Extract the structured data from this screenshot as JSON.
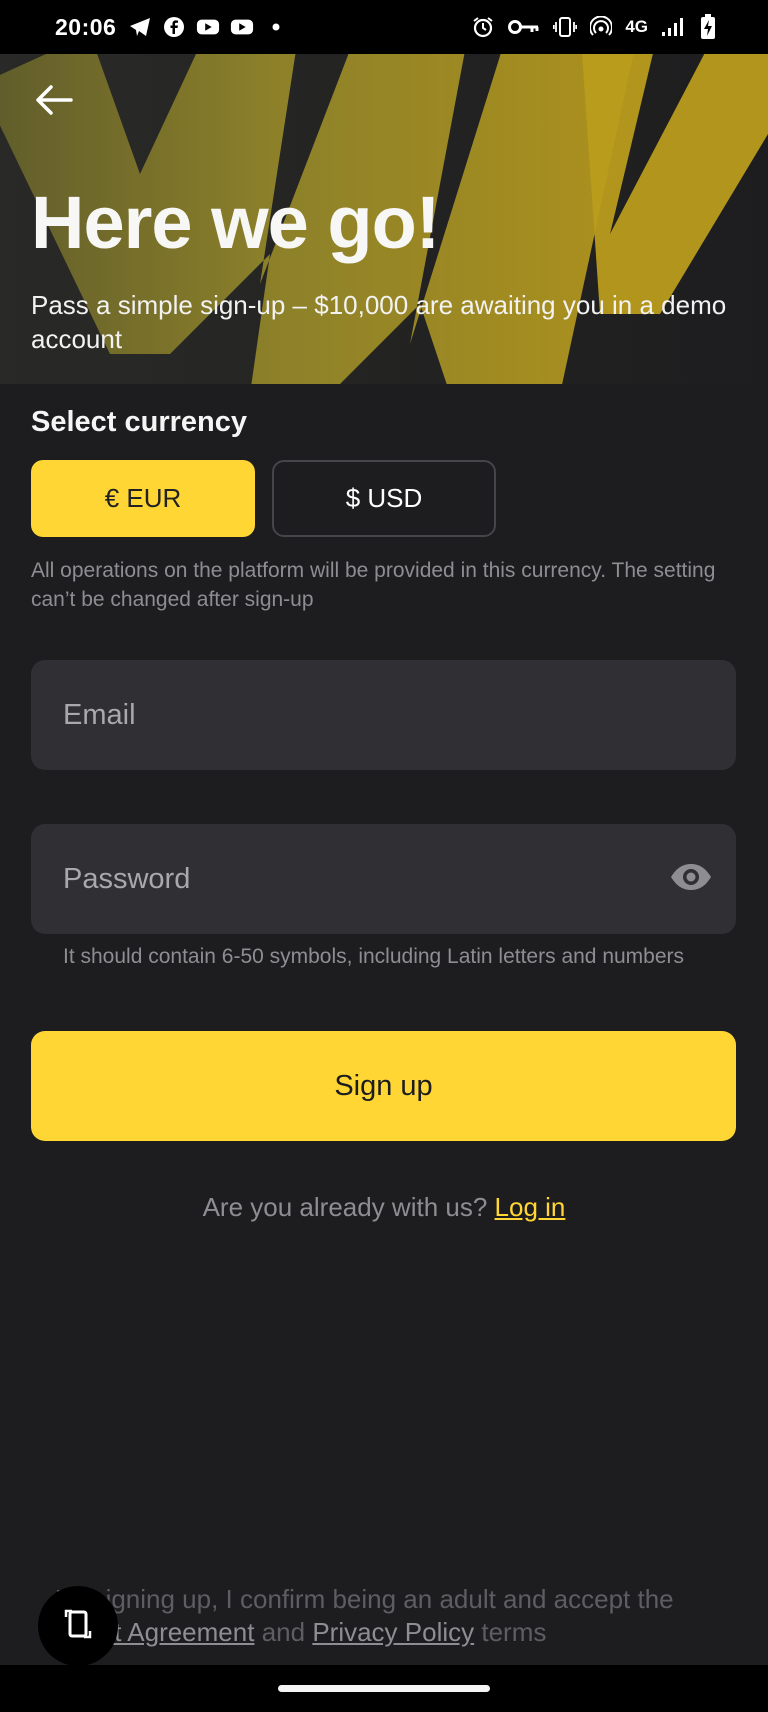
{
  "status_bar": {
    "time": "20:06",
    "network": "4G",
    "left_icons": [
      "telegram-icon",
      "facebook-icon",
      "youtube-icon",
      "youtube-icon",
      "dot-icon"
    ],
    "right_icons": [
      "alarm-icon",
      "key-icon",
      "vibrate-icon",
      "hotspot-icon",
      "signal-icon",
      "battery-icon"
    ]
  },
  "header": {
    "back_icon": "arrow-left-icon",
    "title": "Here we go!",
    "subtitle": "Pass a simple sign-up – $10,000 are awaiting you in a demo account"
  },
  "currency": {
    "label": "Select currency",
    "options": [
      {
        "label": "€ EUR",
        "selected": true
      },
      {
        "label": "$ USD",
        "selected": false
      }
    ],
    "note": "All operations on the platform will be provided in this currency. The setting can’t be changed after sign-up"
  },
  "form": {
    "email_placeholder": "Email",
    "password_placeholder": "Password",
    "password_hint": "It should contain 6-50 symbols, including Latin letters and numbers",
    "submit_label": "Sign up"
  },
  "login": {
    "prompt": "Are you already with us?",
    "link": "Log in"
  },
  "legal": {
    "prefix": "By signing up, I confirm being an adult and accept the",
    "client_agreement": "Client Agreement",
    "and": "and",
    "privacy_policy": "Privacy Policy",
    "suffix": "terms"
  },
  "colors": {
    "accent": "#ffd633",
    "background": "#1d1d1f",
    "field": "#2f2f34",
    "muted_text": "#8e8e92"
  }
}
